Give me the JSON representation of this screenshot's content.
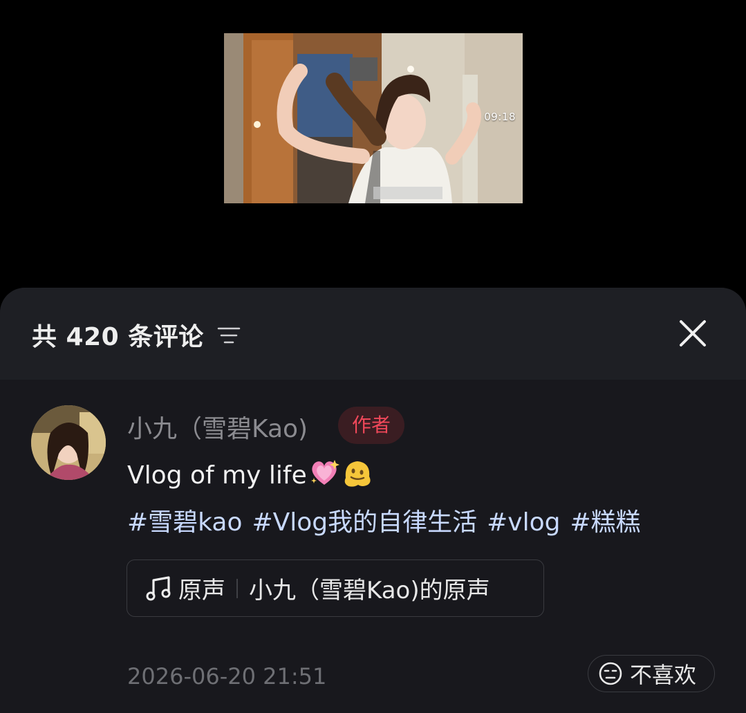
{
  "video": {
    "duration": "09:18"
  },
  "comments_panel": {
    "title": "共 420 条评论",
    "filter_icon": "sort-filter-icon",
    "close_icon": "close-icon"
  },
  "post": {
    "author_name": "小九（雪碧Kao)",
    "author_badge": "作者",
    "caption_text": "Vlog of my life",
    "caption_emojis": [
      "sparkling-heart-emoji",
      "melting-face-emoji"
    ],
    "hashtags": [
      "#雪碧kao",
      "#Vlog我的自律生活",
      "#vlog",
      "#糕糕"
    ],
    "music": {
      "icon": "music-note-icon",
      "label": "原声",
      "title": "小九（雪碧Kao)的原声"
    },
    "timestamp": "2026-06-20 21:51",
    "dislike_label": "不喜欢",
    "dislike_icon": "unamused-face-icon"
  },
  "colors": {
    "background": "#000000",
    "sheet": "#18181d",
    "header": "#1e1f24",
    "badge_text": "#f0485a",
    "hashtag": "#c8d9ff"
  }
}
